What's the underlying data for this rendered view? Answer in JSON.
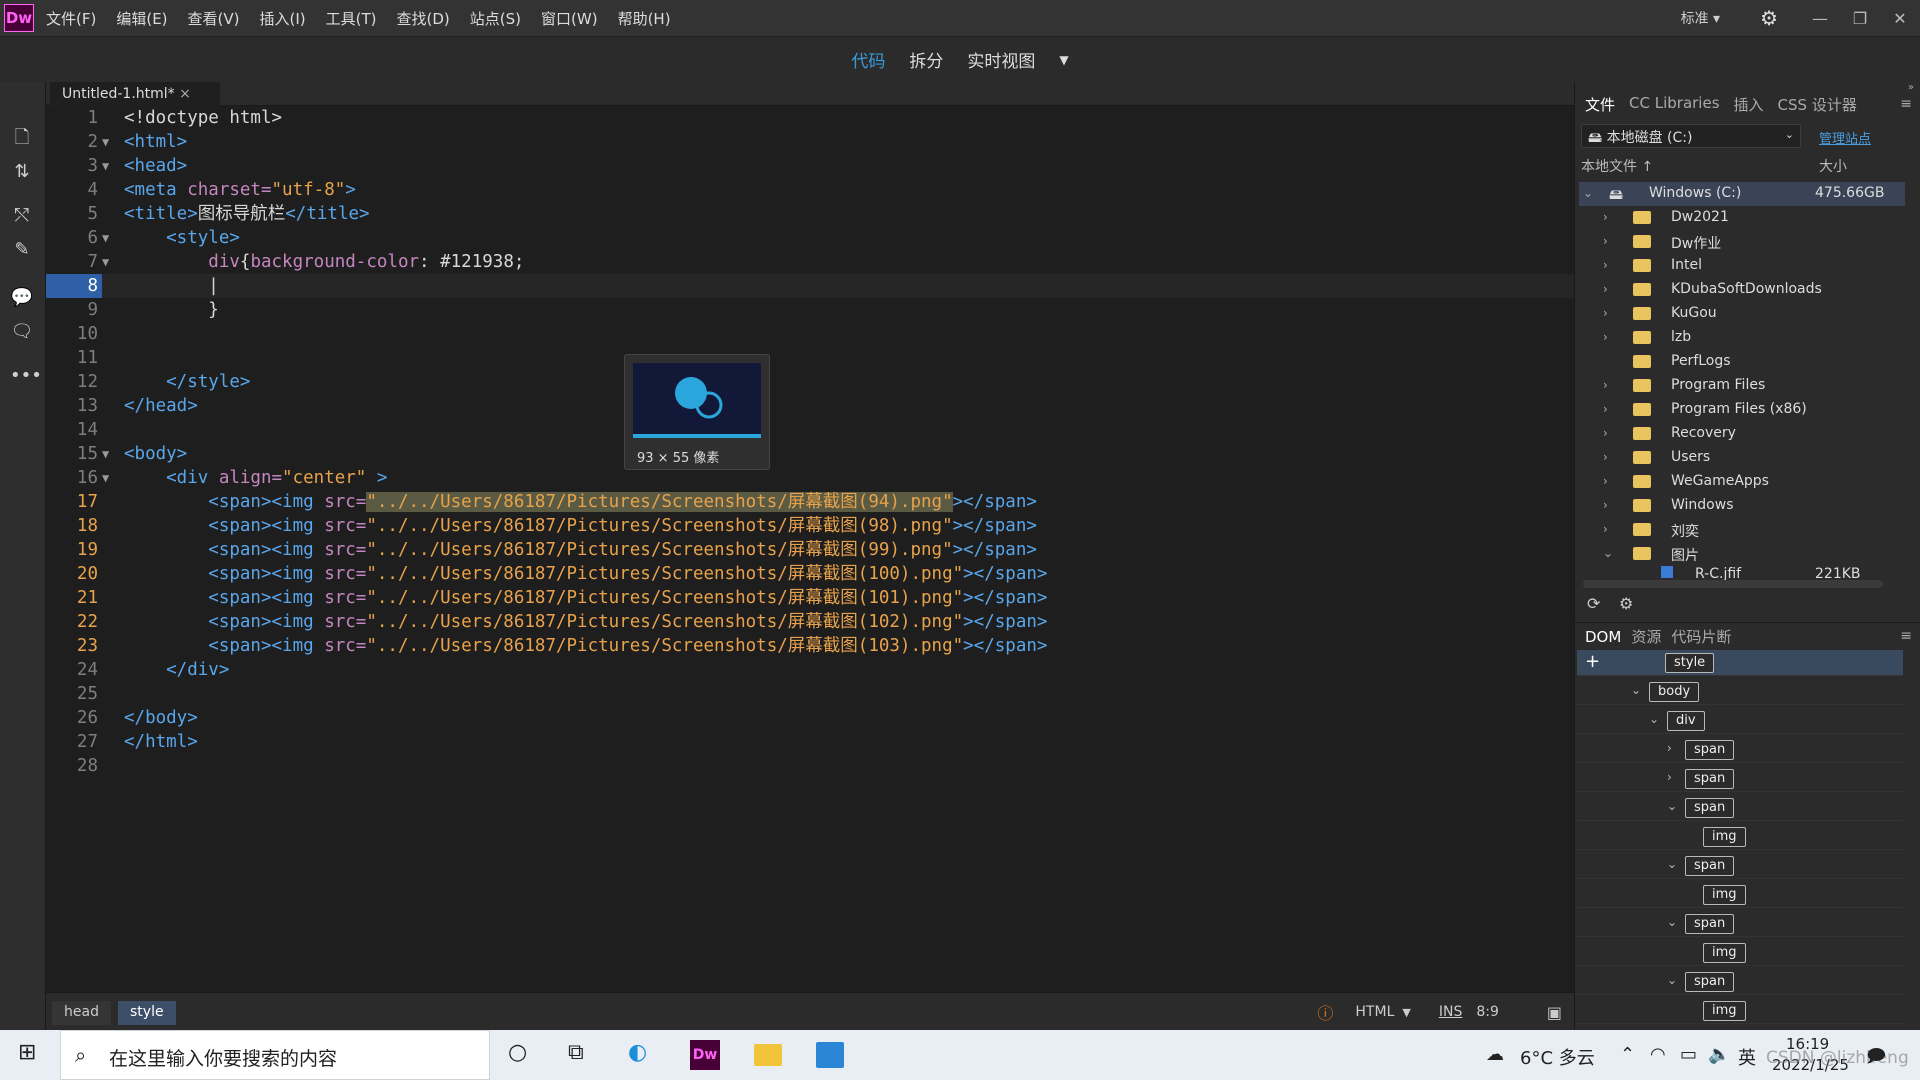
{
  "app": {
    "logo": "Dw"
  },
  "menu": [
    "文件(F)",
    "编辑(E)",
    "查看(V)",
    "插入(I)",
    "工具(T)",
    "查找(D)",
    "站点(S)",
    "窗口(W)",
    "帮助(H)"
  ],
  "workspace": "标准 ▾",
  "views": {
    "code": "代码",
    "split": "拆分",
    "live": "实时视图"
  },
  "doc_tab": "Untitled-1.html*",
  "code": {
    "lines": [
      "1",
      "2",
      "3",
      "4",
      "5",
      "6",
      "7",
      "8",
      "9",
      "10",
      "11",
      "12",
      "13",
      "14",
      "15",
      "16",
      "17",
      "18",
      "19",
      "20",
      "21",
      "22",
      "23",
      "24",
      "25",
      "26",
      "27",
      "28"
    ]
  },
  "tooltip": {
    "size": "93 × 55 像素"
  },
  "status": {
    "crumb_head": "head",
    "crumb_style": "style",
    "lang": "HTML",
    "mode": "INS",
    "pos": "8:9"
  },
  "panel": {
    "tabs": [
      "文件",
      "CC Libraries",
      "插入",
      "CSS 设计器"
    ],
    "drive": "本地磁盘 (C:)",
    "manage": "管理站点",
    "col_local": "本地文件 ↑",
    "col_size": "大小",
    "root": {
      "name": "Windows (C:)",
      "size": "475.66GB"
    },
    "folders": [
      "Dw2021",
      "Dw作业",
      "Intel",
      "KDubaSoftDownloads",
      "KuGou",
      "lzb",
      "PerfLogs",
      "Program Files",
      "Program Files (x86)",
      "Recovery",
      "Users",
      "WeGameApps",
      "Windows",
      "刘奕",
      "图片"
    ],
    "file": {
      "name": "R-C.jfif",
      "size": "221KB"
    }
  },
  "dom": {
    "tabs": [
      "DOM",
      "资源",
      "代码片断"
    ],
    "nodes": [
      "style",
      "body",
      "div",
      "span",
      "span",
      "span",
      "img",
      "span",
      "img",
      "span",
      "img",
      "span",
      "img"
    ]
  },
  "taskbar": {
    "search": "在这里输入你要搜索的内容",
    "weather": "6°C 多云",
    "ime": "英",
    "time": "16:19",
    "date": "2022/1/25",
    "watermark": "CSDN @lizhifeng"
  },
  "colors": {
    "accent": "#3a9bdc",
    "tag": "#5aa6ea",
    "string": "#e8a24c",
    "attr": "#c586c0"
  }
}
